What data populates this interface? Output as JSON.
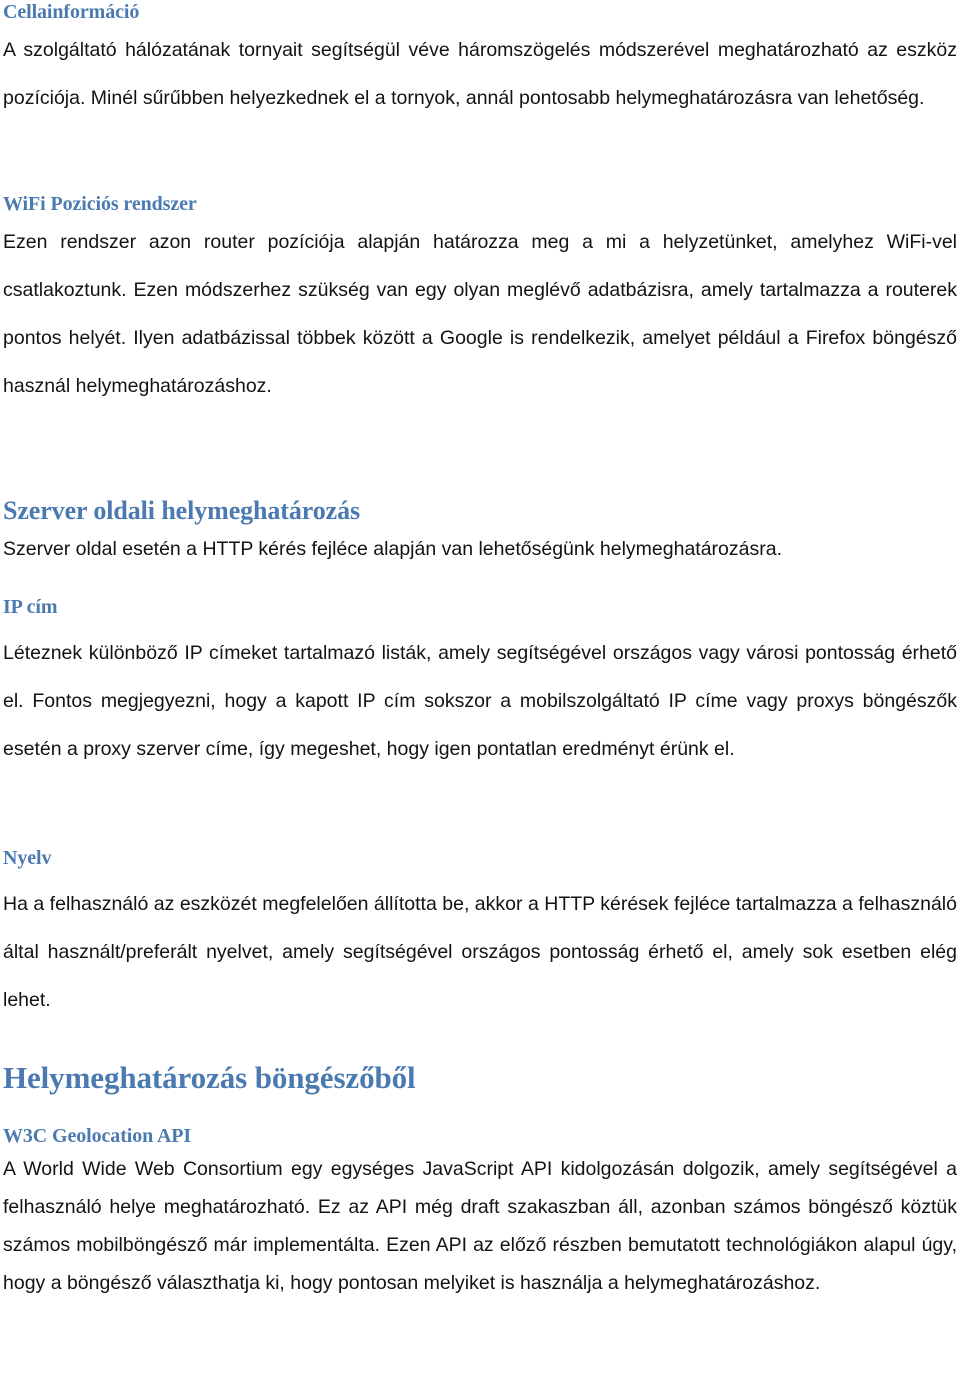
{
  "document": {
    "language": "hu",
    "colors": {
      "heading_blue": "#4a7ab0",
      "body_text": "#131313",
      "background": "#ffffff"
    }
  },
  "sections": [
    {
      "id": "cellainformacio",
      "level": 3,
      "heading": "Cellainformáció",
      "paragraph": "A szolgáltató hálózatának tornyait segítségül véve háromszögelés módszerével meghatározható az eszköz pozíciója. Minél sűrűbben helyezkednek el a tornyok, annál pontosabb helymeghatározásra van lehetőség."
    },
    {
      "id": "wifi-pozicios-rendszer",
      "level": 3,
      "heading": "WiFi Poziciós rendszer",
      "paragraph": "Ezen rendszer azon router pozíciója alapján határozza meg a mi a helyzetünket, amelyhez WiFi-vel csatlakoztunk. Ezen módszerhez szükség van egy olyan meglévő adatbázisra, amely tartalmazza a routerek pontos helyét. Ilyen adatbázissal többek között a Google is rendelkezik, amelyet például a Firefox böngésző használ helymeghatározáshoz."
    },
    {
      "id": "szerver-oldali-helymeghatarozas",
      "level": 2,
      "heading": "Szerver oldali helymeghatározás",
      "paragraph": "Szerver oldal esetén a HTTP kérés fejléce alapján van lehetőségünk helymeghatározásra."
    },
    {
      "id": "ip-cim",
      "level": 3,
      "heading": "IP cím",
      "paragraph": "Léteznek különböző IP címeket tartalmazó listák, amely segítségével országos vagy városi pontosság érhető el. Fontos megjegyezni, hogy a kapott IP cím sokszor a mobilszolgáltató IP címe vagy proxys böngészők esetén a proxy szerver címe, így megeshet, hogy igen pontatlan eredményt érünk el."
    },
    {
      "id": "nyelv",
      "level": 3,
      "heading": "Nyelv",
      "paragraph": "Ha a felhasználó az eszközét megfelelően állította be, akkor a HTTP kérések fejléce tartalmazza a felhasználó által használt/preferált nyelvet, amely segítségével országos pontosság érhető el, amely sok esetben elég lehet."
    },
    {
      "id": "helymeghatarozas-bongeszobol",
      "level": 1,
      "heading": "Helymeghatározás böngészőből",
      "paragraph": ""
    },
    {
      "id": "w3c-geolocation-api",
      "level": 3,
      "heading": "W3C Geolocation API",
      "paragraph": "A World Wide Web Consortium egy egységes JavaScript API kidolgozásán dolgozik, amely segítségével a felhasználó helye meghatározható. Ez az API még draft szakaszban áll, azonban számos böngésző köztük számos mobilböngésző már implementálta. Ezen API az előző részben bemutatott technológiákon alapul úgy, hogy a böngésző választhatja ki, hogy pontosan melyiket is használja a helymeghatározáshoz."
    }
  ]
}
